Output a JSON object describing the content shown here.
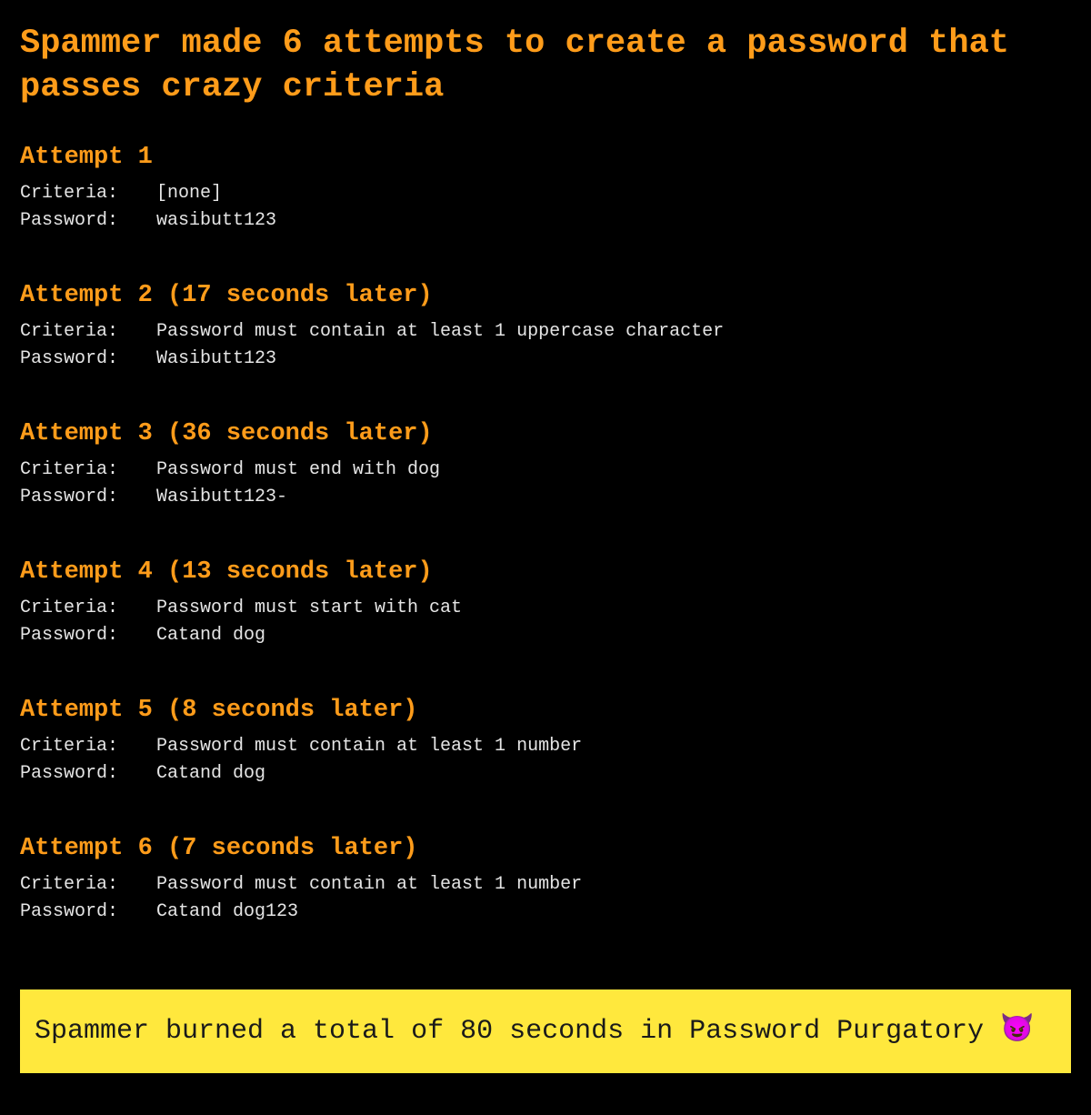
{
  "title": "Spammer made 6 attempts to create a password that passes crazy criteria",
  "labels": {
    "criteria": "Criteria:",
    "password": "Password:"
  },
  "attempts": [
    {
      "heading": "Attempt 1",
      "criteria": "[none]",
      "password": "wasibutt123"
    },
    {
      "heading": "Attempt 2 (17 seconds later)",
      "criteria": "Password must contain at least 1 uppercase character",
      "password": "Wasibutt123"
    },
    {
      "heading": "Attempt 3 (36 seconds later)",
      "criteria": "Password must end with dog",
      "password": "Wasibutt123-"
    },
    {
      "heading": "Attempt 4 (13 seconds later)",
      "criteria": "Password must start with cat",
      "password": "Catand dog"
    },
    {
      "heading": "Attempt 5 (8 seconds later)",
      "criteria": "Password must contain at least 1 number",
      "password": "Catand dog"
    },
    {
      "heading": "Attempt 6 (7 seconds later)",
      "criteria": "Password must contain at least 1 number",
      "password": "Catand dog123"
    }
  ],
  "summary": {
    "text": "Spammer burned a total of 80 seconds in Password Purgatory ",
    "emoji": "😈"
  }
}
